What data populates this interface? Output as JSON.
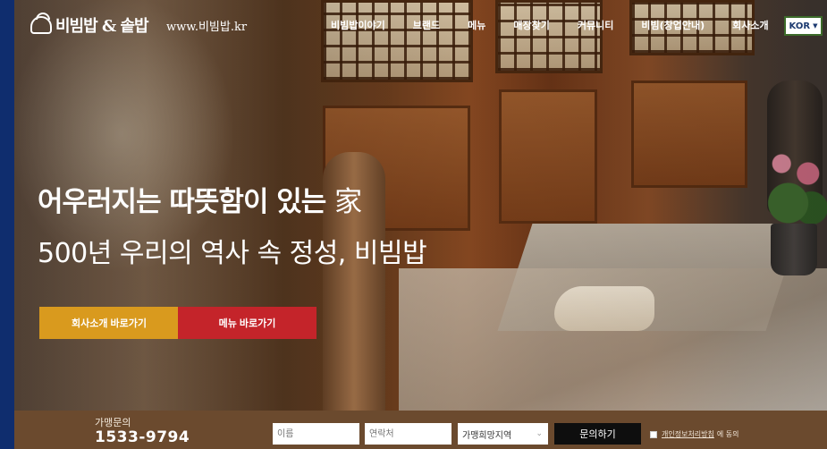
{
  "header": {
    "logo_text": "비빔밥 & 솥밥",
    "site_url": "www.비빔밥.kr",
    "nav": [
      "비빔밥이야기",
      "브랜드",
      "메뉴",
      "매장찾기",
      "커뮤니티",
      "비빔(창업안내)",
      "회사소개"
    ],
    "language": "KOR"
  },
  "hero": {
    "headline": "어우러지는 따뜻함이 있는",
    "headline_han": "家",
    "subheadline": "500년 우리의 역사 속 정성, 비빔밥",
    "btn_about": "회사소개 바로가기",
    "btn_menu": "메뉴 바로가기"
  },
  "inquiry": {
    "label": "가맹문의",
    "phone": "1533-9794",
    "name_placeholder": "이름",
    "contact_placeholder": "연락처",
    "region_value": "가맹희망지역",
    "submit": "문의하기",
    "policy_link": "개인정보처리방침",
    "agree_suffix": "에 동의"
  },
  "colors": {
    "border": "#0f2d6e",
    "btn_about": "#d99a1e",
    "btn_menu": "#c4242a",
    "bar": "#6b4a2e",
    "submit": "#0e0e0e"
  }
}
